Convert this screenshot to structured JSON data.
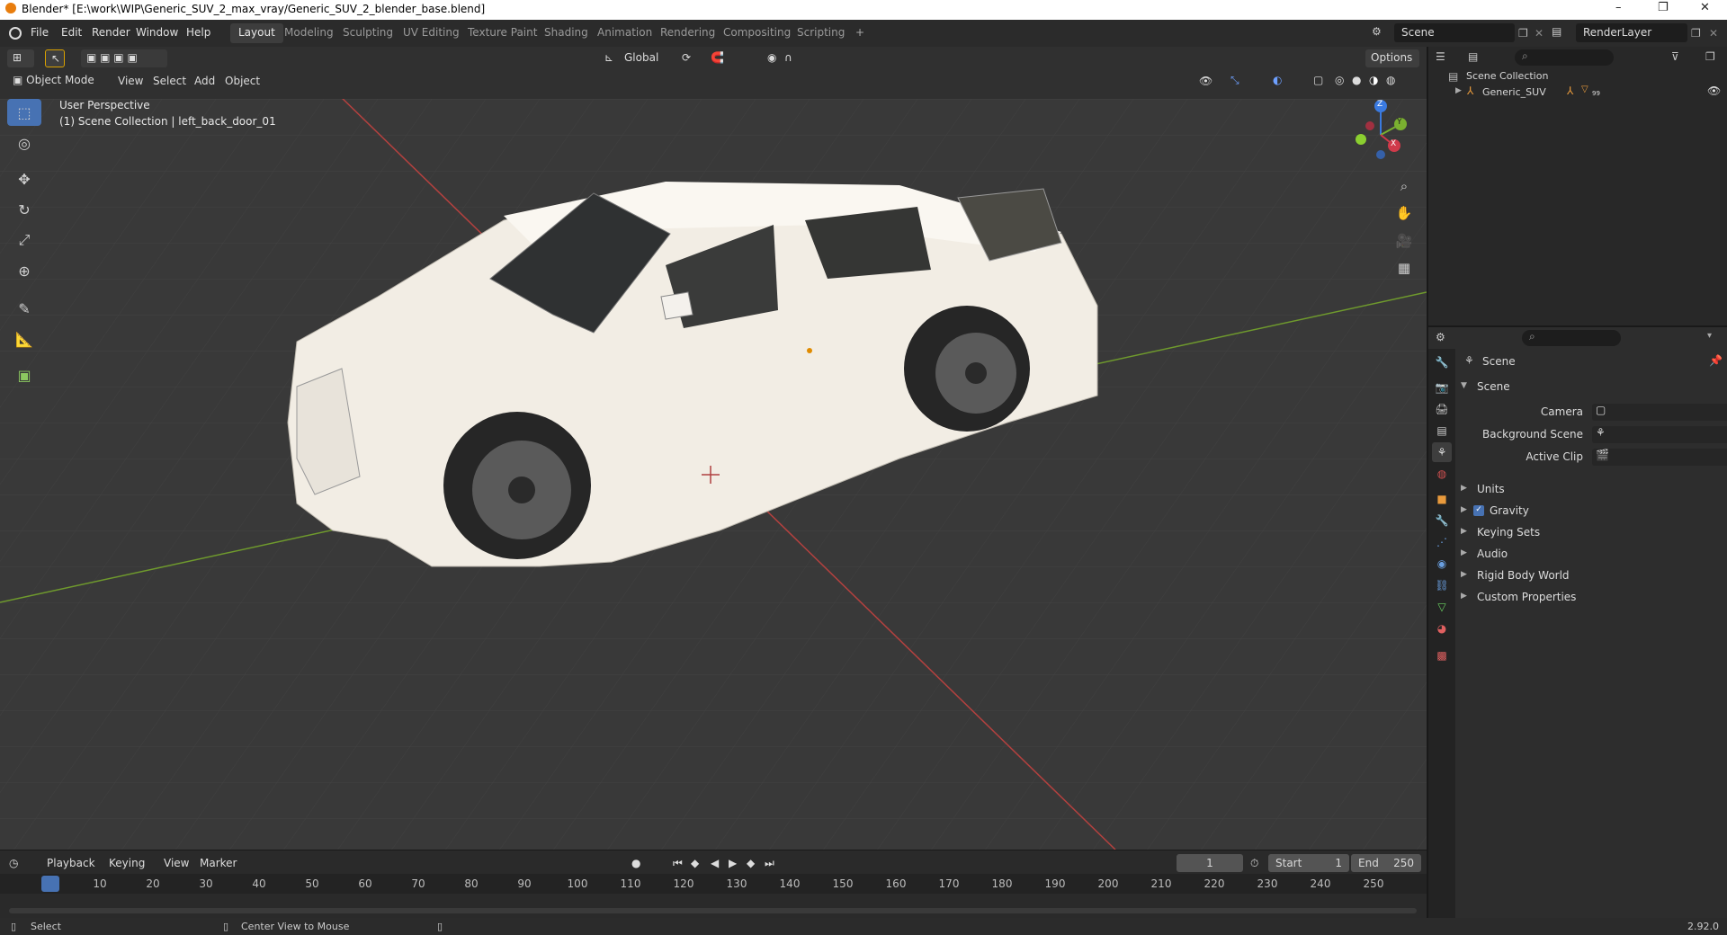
{
  "window": {
    "title": "Blender* [E:\\work\\WIP\\Generic_SUV_2_max_vray/Generic_SUV_2_blender_base.blend]",
    "controls": [
      "–",
      "❐",
      "✕"
    ]
  },
  "menubar": {
    "items": [
      "File",
      "Edit",
      "Render",
      "Window",
      "Help"
    ],
    "workspaces": [
      "Layout",
      "Modeling",
      "Sculpting",
      "UV Editing",
      "Texture Paint",
      "Shading",
      "Animation",
      "Rendering",
      "Compositing",
      "Scripting"
    ],
    "active_workspace": "Layout",
    "add_workspace": "+",
    "scene_name": "Scene",
    "view_layer": "RenderLayer"
  },
  "viewport_header": {
    "orientation": "Global",
    "options": "Options",
    "mode": "Object Mode",
    "menus": [
      "View",
      "Select",
      "Add",
      "Object"
    ]
  },
  "viewport": {
    "view_name": "User Perspective",
    "collection_info": "(1) Scene Collection | left_back_door_01",
    "gizmo": {
      "x": "X",
      "y": "Y",
      "z": "Z"
    },
    "background": "#393939",
    "x_axis_color": "#b4413f",
    "y_axis_color": "#6f9a2d"
  },
  "outliner": {
    "root": "Scene Collection",
    "items": [
      {
        "name": "Generic_SUV",
        "count": "99"
      }
    ]
  },
  "properties": {
    "context": "Scene",
    "panel": "Scene",
    "fields": [
      {
        "label": "Camera"
      },
      {
        "label": "Background Scene"
      },
      {
        "label": "Active Clip"
      }
    ],
    "sections": [
      "Units",
      "Gravity",
      "Keying Sets",
      "Audio",
      "Rigid Body World",
      "Custom Properties"
    ],
    "gravity_checked": true
  },
  "timeline": {
    "menus": [
      "Playback",
      "Keying",
      "View",
      "Marker"
    ],
    "current_frame": "1",
    "start_label": "Start",
    "start": "1",
    "end_label": "End",
    "end": "250",
    "ticks": [
      "1",
      "10",
      "20",
      "30",
      "40",
      "50",
      "60",
      "70",
      "80",
      "90",
      "100",
      "110",
      "120",
      "130",
      "140",
      "150",
      "160",
      "170",
      "180",
      "190",
      "200",
      "210",
      "220",
      "230",
      "240",
      "250"
    ]
  },
  "statusbar": {
    "left": "Select",
    "middle": "Center View to Mouse",
    "version": "2.92.0"
  }
}
